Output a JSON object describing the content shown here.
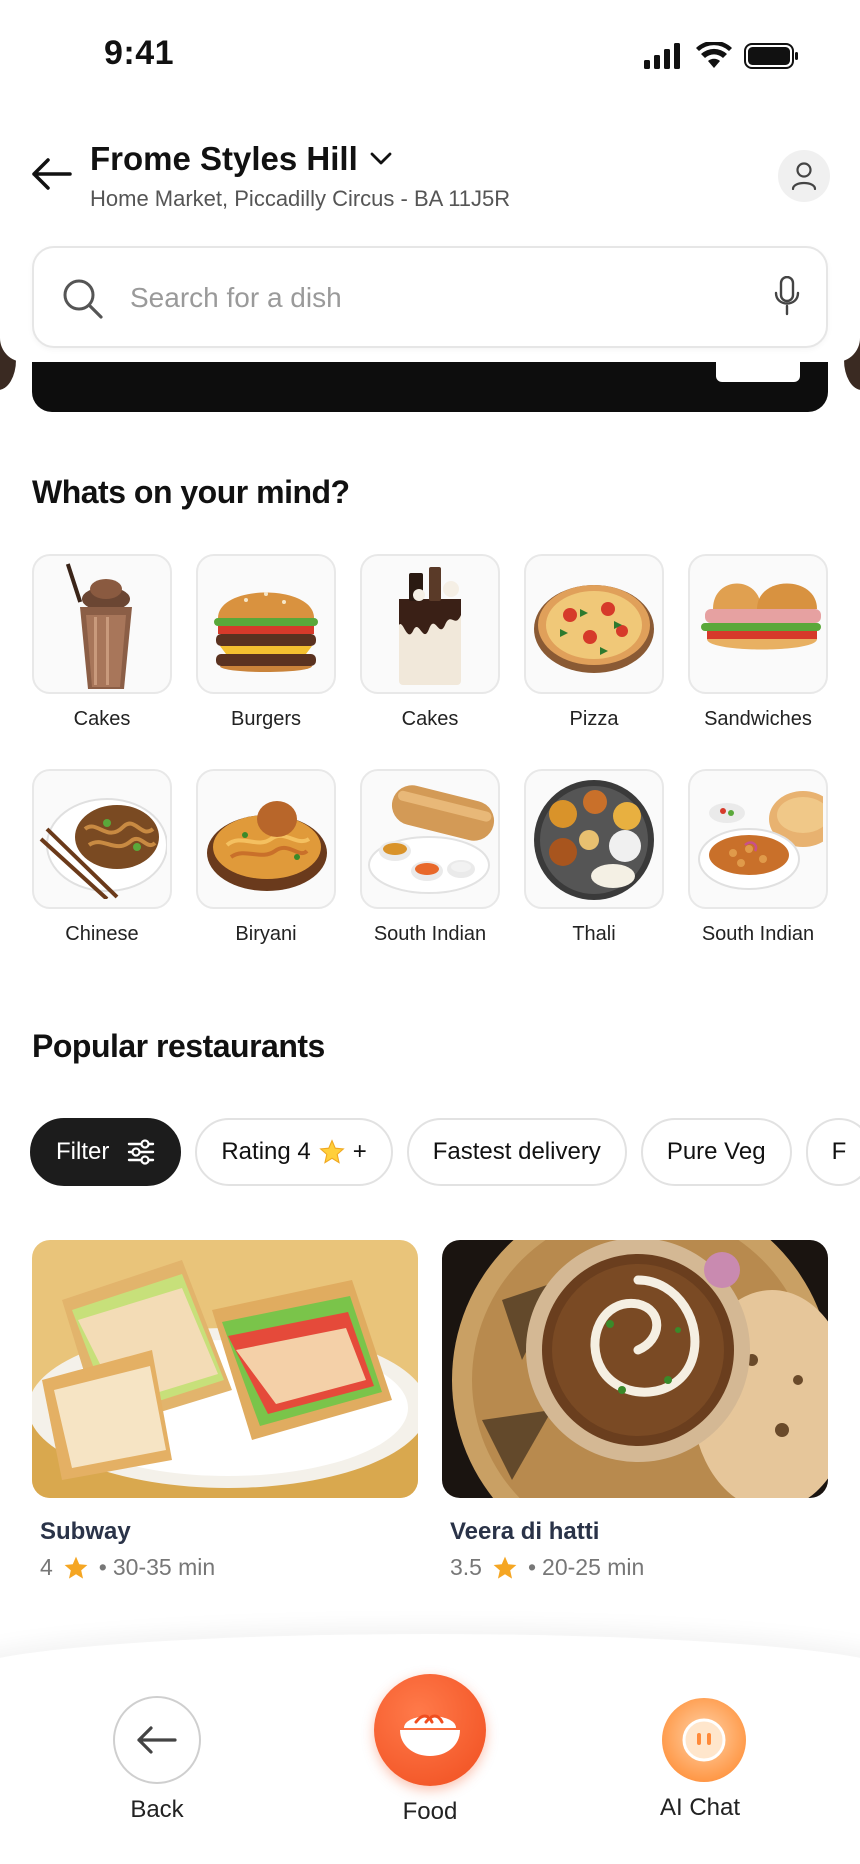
{
  "status_bar": {
    "time": "9:41"
  },
  "header": {
    "location_name": "Frome Styles Hill",
    "address": "Home Market, Piccadilly Circus - BA 11J5R"
  },
  "search": {
    "placeholder": "Search for a dish"
  },
  "categories_section": {
    "title": "Whats on your mind?",
    "items": [
      {
        "label": "Cakes",
        "icon": "milkshake"
      },
      {
        "label": "Burgers",
        "icon": "burger"
      },
      {
        "label": "Cakes",
        "icon": "cake"
      },
      {
        "label": "Pizza",
        "icon": "pizza"
      },
      {
        "label": "Sandwiches",
        "icon": "sandwich"
      },
      {
        "label": "Chinese",
        "icon": "noodles"
      },
      {
        "label": "Biryani",
        "icon": "biryani"
      },
      {
        "label": "South Indian",
        "icon": "dosa"
      },
      {
        "label": "Thali",
        "icon": "thali"
      },
      {
        "label": "South Indian",
        "icon": "chole-bhature"
      }
    ]
  },
  "restaurants_section": {
    "title": "Popular restaurants",
    "filters": [
      {
        "label": "Filter",
        "active": true
      },
      {
        "label": "Rating 4",
        "suffix": "+"
      },
      {
        "label": "Fastest delivery"
      },
      {
        "label": "Pure Veg"
      },
      {
        "label": "F"
      }
    ],
    "items": [
      {
        "name": "Subway",
        "rating": "4",
        "time": "30-35 min"
      },
      {
        "name": "Veera di hatti",
        "rating": "3.5",
        "time": "20-25 min"
      }
    ]
  },
  "bottom_nav": {
    "back_label": "Back",
    "food_label": "Food",
    "chat_label": "AI Chat"
  },
  "colors": {
    "accent": "#f04e1f",
    "star": "#f5a623",
    "dark_chip": "#1c1c1c",
    "restaurant_name": "#2a3348"
  }
}
